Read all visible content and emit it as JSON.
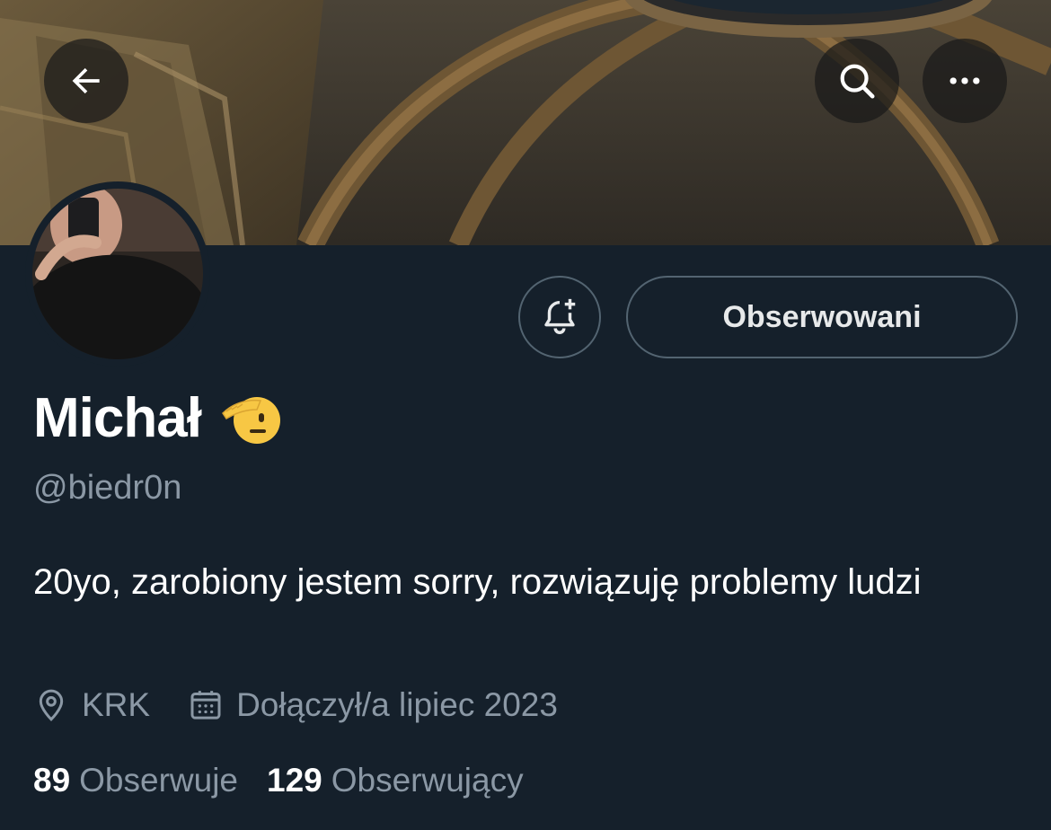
{
  "header": {
    "back_icon": "arrow-left-icon",
    "search_icon": "search-icon",
    "more_icon": "more-horizontal-icon"
  },
  "profile": {
    "display_name": "Michał",
    "name_emoji": "saluting-face-icon",
    "handle": "@biedr0n",
    "bio": "20yo, zarobiony jestem sorry, rozwiązuję problemy ludzi",
    "location": "KRK",
    "joined": "Dołączył/a lipiec 2023"
  },
  "actions": {
    "notify_icon": "bell-plus-icon",
    "follow_label": "Obserwowani"
  },
  "stats": {
    "following_count": "89",
    "following_label": "Obserwuje",
    "followers_count": "129",
    "followers_label": "Obserwujący"
  },
  "colors": {
    "background": "#15202b",
    "primary_text": "#e7e9ea",
    "secondary_text": "#8b98a5",
    "border": "#536471"
  }
}
